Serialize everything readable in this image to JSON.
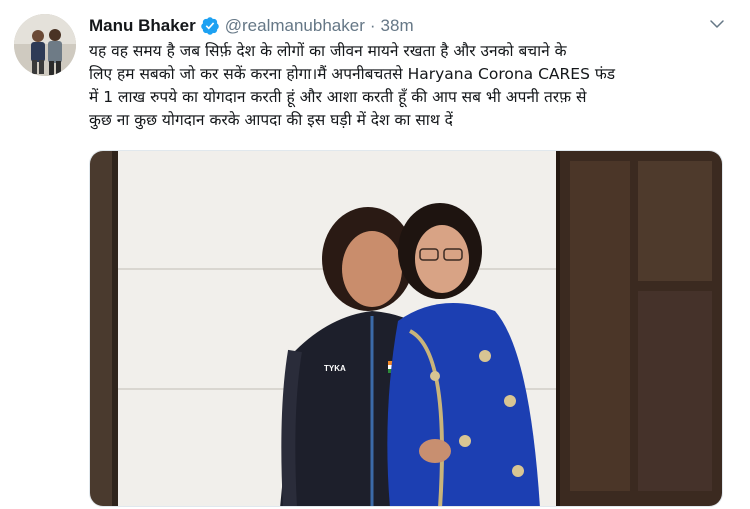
{
  "tweet": {
    "display_name": "Manu Bhaker",
    "verified_icon": "verified-badge-icon",
    "handle": "@realmanubhaker",
    "separator": "·",
    "time": "38m",
    "menu_icon": "chevron-down-icon",
    "text_lines": [
      "यह वह समय है जब सिर्फ़ देश के लोगों का जीवन मायने रखता है और उनको बचाने के",
      "लिए हम सबको जो कर सकें करना होगा।मैं अपनीबचतसे Haryana Corona CARES फंड",
      "में 1 लाख रुपये का योगदान करती हूं और आशा करती हूँ की आप सब भी अपनी तरफ़ से",
      "कुछ ना कुछ योगदान करके आपदा की इस घड़ी में देश का साथ दें"
    ],
    "media": {
      "jacket_text": "TYKA"
    }
  },
  "colors": {
    "name": "#14171a",
    "secondary": "#657786",
    "verified": "#1da1f2"
  }
}
